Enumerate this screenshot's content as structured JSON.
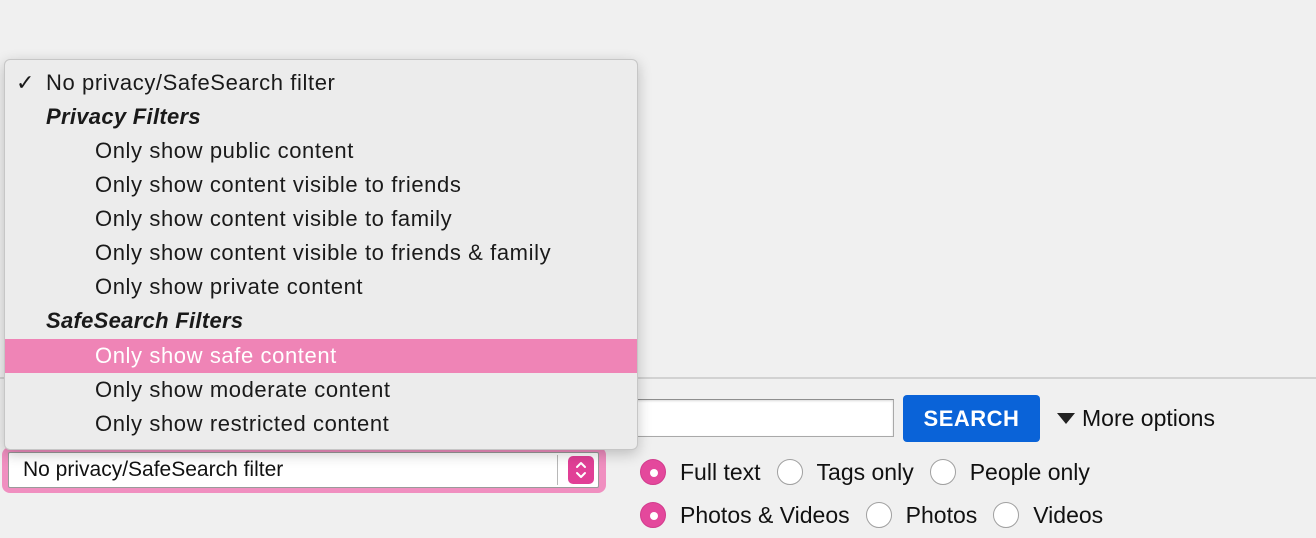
{
  "menu": {
    "items": [
      {
        "label": "No privacy/SafeSearch filter",
        "kind": "option",
        "checked": true
      },
      {
        "label": "Privacy Filters",
        "kind": "group"
      },
      {
        "label": "Only show public content",
        "kind": "option"
      },
      {
        "label": "Only show content visible to friends",
        "kind": "option"
      },
      {
        "label": "Only show content visible to family",
        "kind": "option"
      },
      {
        "label": "Only show content visible to friends & family",
        "kind": "option"
      },
      {
        "label": "Only show private content",
        "kind": "option"
      },
      {
        "label": "SafeSearch Filters",
        "kind": "group"
      },
      {
        "label": "Only show safe content",
        "kind": "option",
        "highlighted": true
      },
      {
        "label": "Only show moderate content",
        "kind": "option"
      },
      {
        "label": "Only show restricted content",
        "kind": "option"
      }
    ],
    "check_glyph": "✓"
  },
  "select": {
    "value": "No privacy/SafeSearch filter",
    "icon": "select-arrows-icon"
  },
  "search": {
    "input_value": "",
    "button_label": "SEARCH",
    "more_options_label": "More options"
  },
  "search_scope": [
    {
      "label": "Full text",
      "checked": true
    },
    {
      "label": "Tags only",
      "checked": false
    },
    {
      "label": "People only",
      "checked": false
    }
  ],
  "media_type": [
    {
      "label": "Photos & Videos",
      "checked": true
    },
    {
      "label": "Photos",
      "checked": false
    },
    {
      "label": "Videos",
      "checked": false
    }
  ],
  "colors": {
    "accent_pink": "#e4489c",
    "highlight_pink": "#ef84b6",
    "search_blue": "#0a63d8"
  }
}
